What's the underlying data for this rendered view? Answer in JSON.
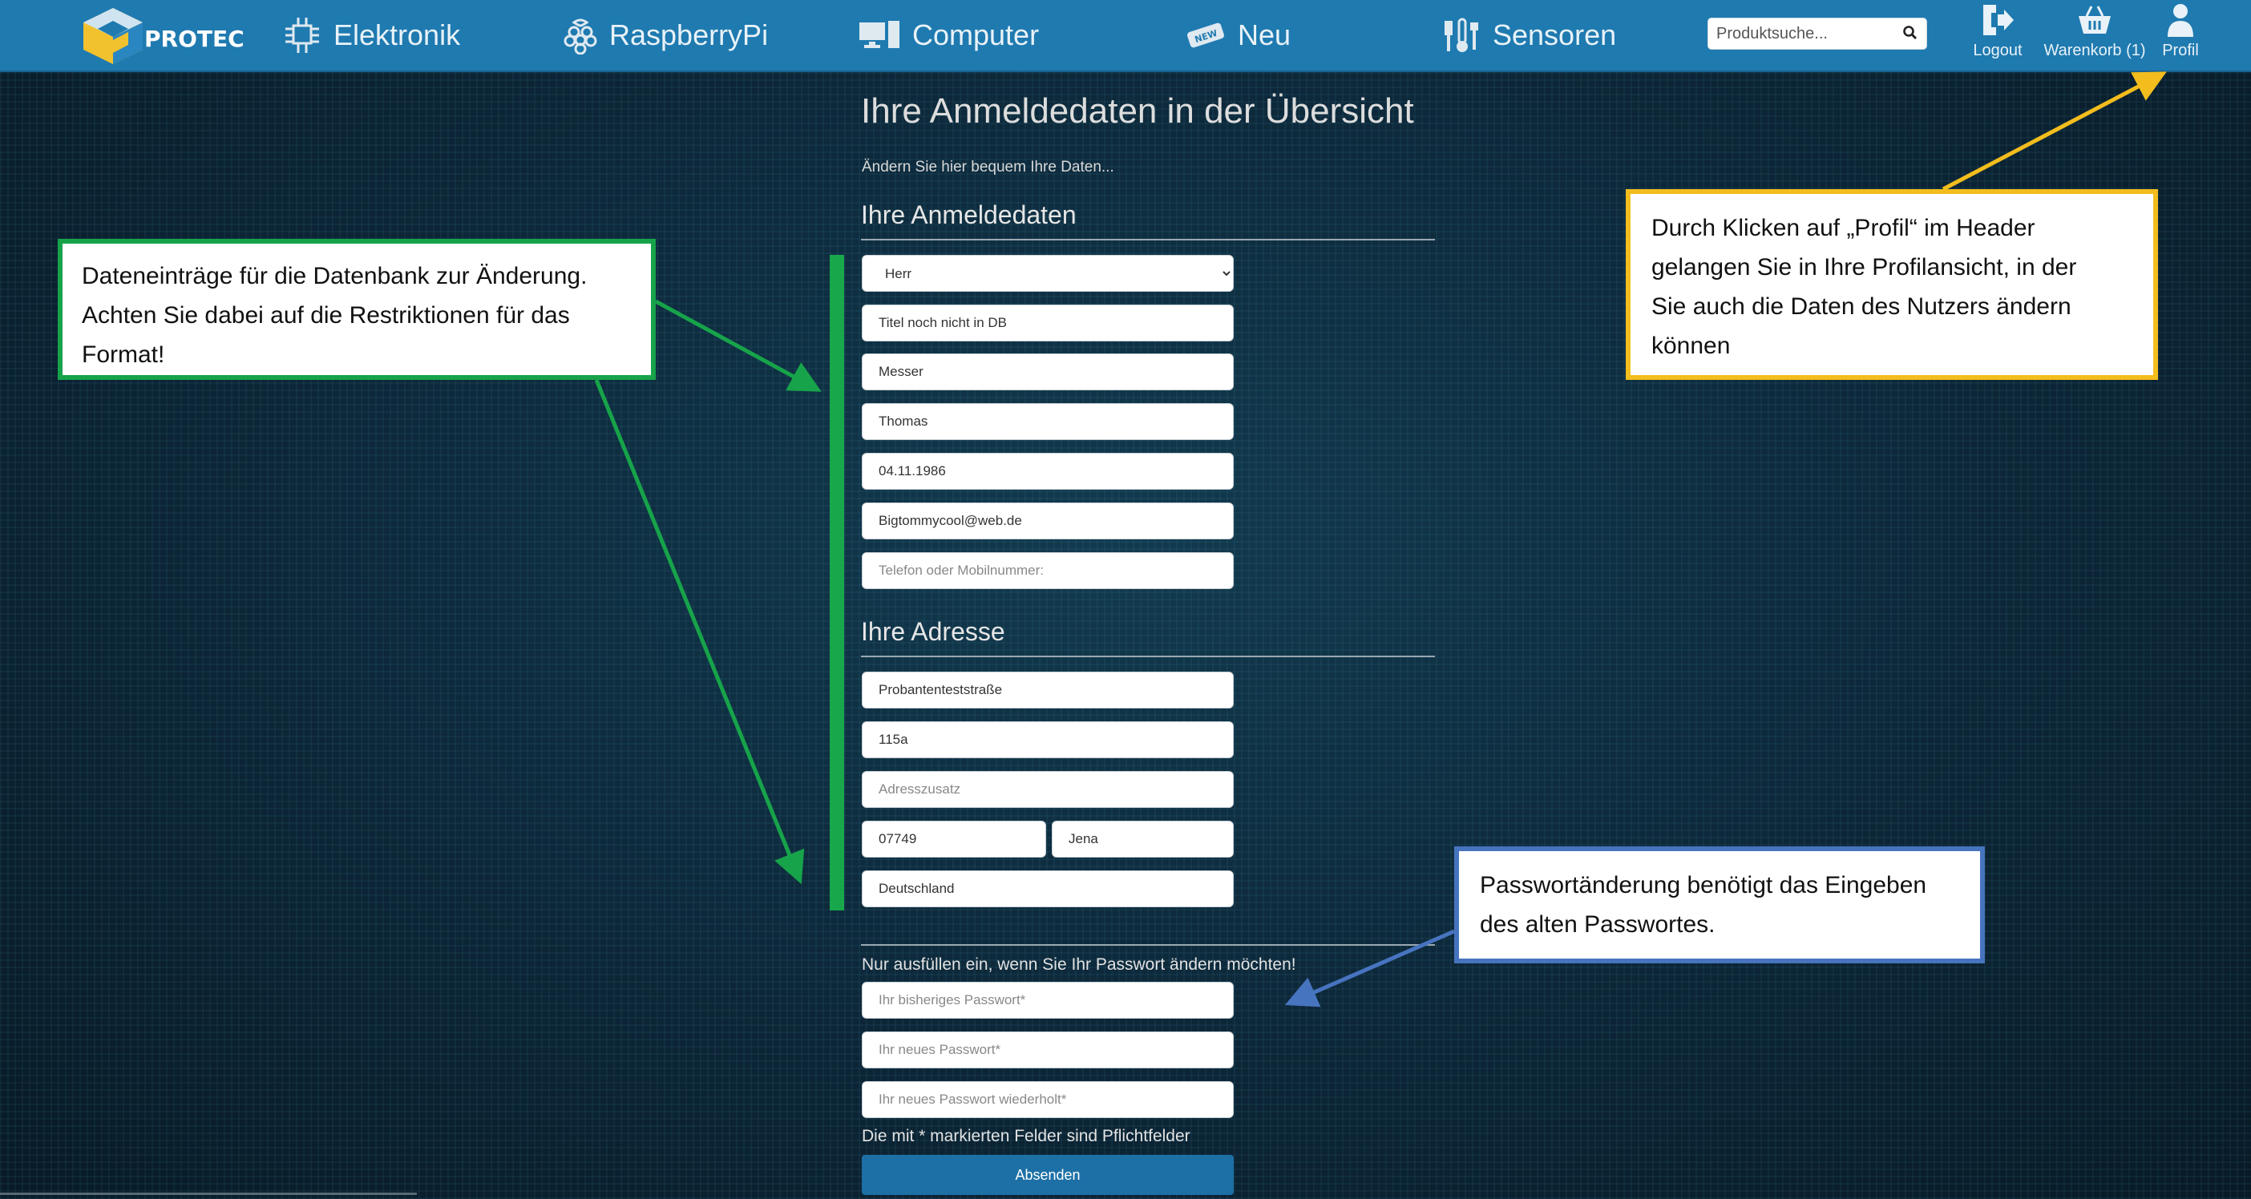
{
  "header": {
    "logo_text": "PROTEC",
    "nav": [
      {
        "label": "Elektronik",
        "icon": "circuit-icon"
      },
      {
        "label": "RaspberryPi",
        "icon": "raspberry-icon"
      },
      {
        "label": "Computer",
        "icon": "computer-icon"
      },
      {
        "label": "Neu",
        "icon": "new-badge-icon"
      },
      {
        "label": "Sensoren",
        "icon": "sensor-icon"
      }
    ],
    "search_placeholder": "Produktsuche...",
    "logout_label": "Logout",
    "cart_label": "Warenkorb (1)",
    "profile_label": "Profil"
  },
  "page": {
    "title": "Ihre Anmeldedaten in der Übersicht",
    "subtitle": "Ändern Sie hier bequem Ihre Daten...",
    "login_section_title": "Ihre Anmeldedaten",
    "salutation": {
      "selected": "Herr",
      "options": [
        "Herr"
      ]
    },
    "title_field": "Titel noch nicht in DB",
    "lastname": "Messer",
    "firstname": "Thomas",
    "birthdate": "04.11.1986",
    "email": "Bigtommycool@web.de",
    "phone_placeholder": "Telefon oder Mobilnummer:",
    "address_section_title": "Ihre Adresse",
    "street": "Probantenteststraße",
    "house_number": "115a",
    "address_extra_placeholder": "Adresszusatz",
    "zip": "07749",
    "city": "Jena",
    "country": "Deutschland",
    "password_hint": "Nur ausfüllen ein, wenn Sie Ihr Passwort ändern möchten!",
    "old_password_placeholder": "Ihr bisheriges Passwort*",
    "new_password_placeholder": "Ihr neues Passwort*",
    "repeat_password_placeholder": "Ihr neues Passwort wiederholt*",
    "required_note": "Die mit * markierten Felder sind Pflichtfelder",
    "submit_label": "Absenden"
  },
  "annotations": {
    "green": [
      "Dateneinträge für die Datenbank zur Änderung.",
      "Achten Sie dabei auf die Restriktionen für das",
      "Format!"
    ],
    "yellow": [
      "Durch Klicken auf „Profil“ im Header",
      "gelangen Sie in Ihre Profilansicht, in der",
      "Sie auch die Daten des Nutzers ändern",
      "können"
    ],
    "blue": [
      "Passwortänderung benötigt das Eingeben",
      "des alten Passwortes."
    ]
  },
  "colors": {
    "header": "#1f7ab0",
    "background": "#0b2131",
    "green": "#17a34a",
    "yellow": "#f2bd1d",
    "blue": "#4774bf",
    "button": "#1d70a6"
  }
}
